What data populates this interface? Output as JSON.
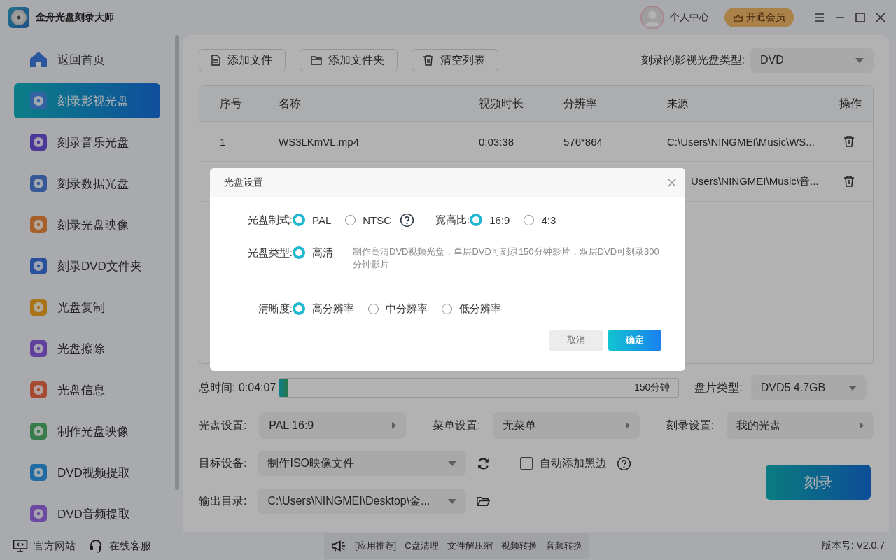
{
  "app": {
    "title": "金舟光盘刻录大师"
  },
  "header": {
    "user_label": "个人中心",
    "vip_button": "开通会员"
  },
  "sidebar": {
    "items": [
      {
        "label": "返回首页",
        "kind": "home",
        "selected": false
      },
      {
        "label": "刻录影视光盘",
        "kind": "video",
        "selected": true
      },
      {
        "label": "刻录音乐光盘",
        "kind": "music",
        "selected": false
      },
      {
        "label": "刻录数据光盘",
        "kind": "data",
        "selected": false
      },
      {
        "label": "刻录光盘映像",
        "kind": "image",
        "selected": false
      },
      {
        "label": "刻录DVD文件夹",
        "kind": "folder",
        "selected": false
      },
      {
        "label": "光盘复制",
        "kind": "copy",
        "selected": false
      },
      {
        "label": "光盘擦除",
        "kind": "erase",
        "selected": false
      },
      {
        "label": "光盘信息",
        "kind": "info",
        "selected": false
      },
      {
        "label": "制作光盘映像",
        "kind": "make",
        "selected": false
      },
      {
        "label": "DVD视频提取",
        "kind": "extract_video",
        "selected": false
      },
      {
        "label": "DVD音频提取",
        "kind": "extract_audio",
        "selected": false
      }
    ]
  },
  "toolbar": {
    "buttons": [
      {
        "label": "添加文件",
        "kind": "file"
      },
      {
        "label": "添加文件夹",
        "kind": "folder"
      },
      {
        "label": "清空列表",
        "kind": "trash"
      }
    ],
    "disc_type_label": "刻录的影视光盘类型:",
    "disc_type": "DVD"
  },
  "table": {
    "columns": [
      "序号",
      "名称",
      "视频时长",
      "分辨率",
      "来源",
      "操作"
    ],
    "rows": [
      {
        "index": "1",
        "name": "WS3LKmVL.mp4",
        "duration": "0:03:38",
        "resolution": "576*864",
        "source": "C:\\Users\\NINGMEI\\Music\\WS..."
      },
      {
        "index": "",
        "name": "",
        "duration": "",
        "resolution": "",
        "source": "Users\\NINGMEI\\Music\\音..."
      }
    ]
  },
  "summary": {
    "total_time": "总时间: 0:04:07",
    "level": 0.02,
    "capacity": "150分钟",
    "disc_size_label": "盘片类型:",
    "disc_size": "DVD5 4.7GB"
  },
  "settings": [
    {
      "label": "光盘设置:",
      "value": "PAL 16:9"
    },
    {
      "label": "菜单设置:",
      "value": "无菜单"
    },
    {
      "label": "刻录设置:",
      "value": "我的光盘"
    }
  ],
  "target": {
    "label": "目标设备:",
    "value": "制作ISO映像文件"
  },
  "auto_black": {
    "label": "自动添加黑边",
    "checked": false
  },
  "output": {
    "label": "输出目录:",
    "value": "C:\\Users\\NINGMEI\\Desktop\\金..."
  },
  "burn_button": "刻录",
  "footer": {
    "links": [
      {
        "label": "官方网站",
        "kind": "web"
      },
      {
        "label": "在线客服",
        "kind": "support"
      }
    ],
    "ad_items": [
      "[应用推荐]",
      "C盘清理",
      "文件解压缩",
      "视频转换",
      "音频转换"
    ],
    "version": "版本号: V2.0.7"
  },
  "dialog": {
    "title": "光盘设置",
    "rows": [
      [
        {
          "label": "光盘制式:",
          "help": true,
          "options": [
            {
              "label": "PAL",
              "selected": true
            },
            {
              "label": "NTSC",
              "selected": false
            }
          ]
        },
        {
          "label": "宽高比:",
          "options": [
            {
              "label": "16:9",
              "selected": true
            },
            {
              "label": "4:3",
              "selected": false
            }
          ]
        }
      ],
      [
        {
          "label": "光盘类型:",
          "options": [
            {
              "label": "高清",
              "selected": true
            }
          ],
          "note": "制作高清DVD视频光盘，单层DVD可刻录150分钟影片，双层DVD可刻录300分钟影片"
        }
      ],
      [
        {
          "label": "清晰度:",
          "options": [
            {
              "label": "高分辨率",
              "selected": true
            },
            {
              "label": "中分辨率",
              "selected": false
            },
            {
              "label": "低分辨率",
              "selected": false
            }
          ]
        }
      ]
    ],
    "cancel": "取消",
    "confirm": "确定"
  }
}
